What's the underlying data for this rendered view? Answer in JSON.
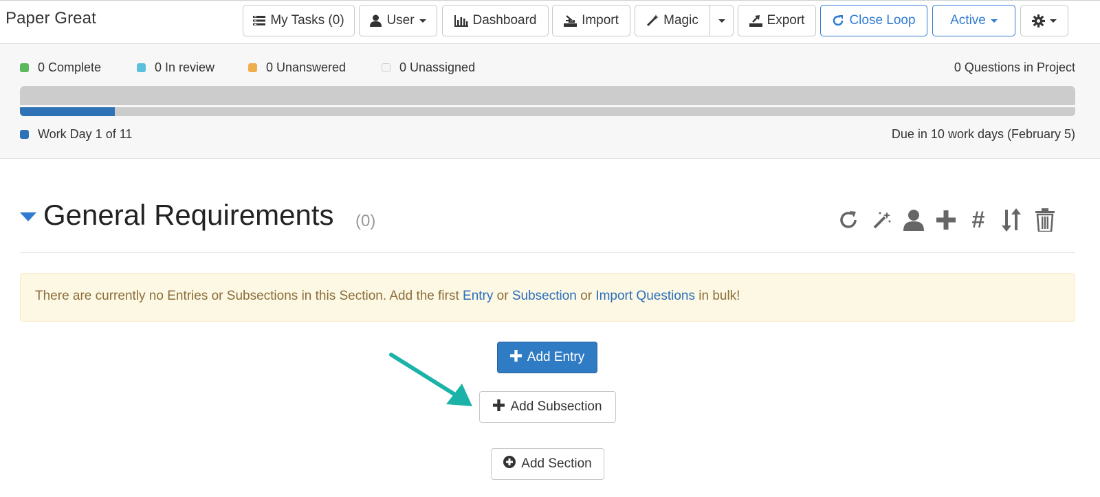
{
  "app": {
    "title": "Paper Great"
  },
  "toolbar": {
    "my_tasks": "My Tasks (0)",
    "user": "User",
    "dashboard": "Dashboard",
    "import": "Import",
    "magic": "Magic",
    "export": "Export",
    "close_loop": "Close Loop",
    "active": "Active"
  },
  "status": {
    "legend": [
      {
        "label": "0 Complete",
        "color": "#5cb85c"
      },
      {
        "label": "0 In review",
        "color": "#5bc0de"
      },
      {
        "label": "0 Unanswered",
        "color": "#f0ad4e"
      },
      {
        "label": "0 Unassigned",
        "color": "#f5f5f5"
      }
    ],
    "questions_in_project": "0 Questions in Project",
    "progress_fraction": 0.09,
    "workday_label": "Work Day 1 of 11",
    "due_label": "Due in 10 work days (February 5)"
  },
  "section": {
    "title": "General Requirements",
    "count": "(0)",
    "tools": [
      "refresh-icon",
      "magic-wand-icon",
      "user-icon",
      "plus-icon",
      "hash-icon",
      "sort-icon",
      "trash-icon"
    ]
  },
  "alert": {
    "text_before": "There are currently no Entries or Subsections in this Section. Add the first ",
    "entry_link": "Entry",
    "or_1": " or ",
    "subsection_link": "Subsection",
    "or_2": " or ",
    "import_link": "Import Questions",
    "text_after": " in bulk!"
  },
  "actions": {
    "add_entry": "Add Entry",
    "add_subsection": "Add Subsection",
    "add_section": "Add Section"
  },
  "colors": {
    "primary": "#2f7bc4",
    "annotation_arrow": "#1bb3a7",
    "alert_bg": "#fcf8e3"
  }
}
